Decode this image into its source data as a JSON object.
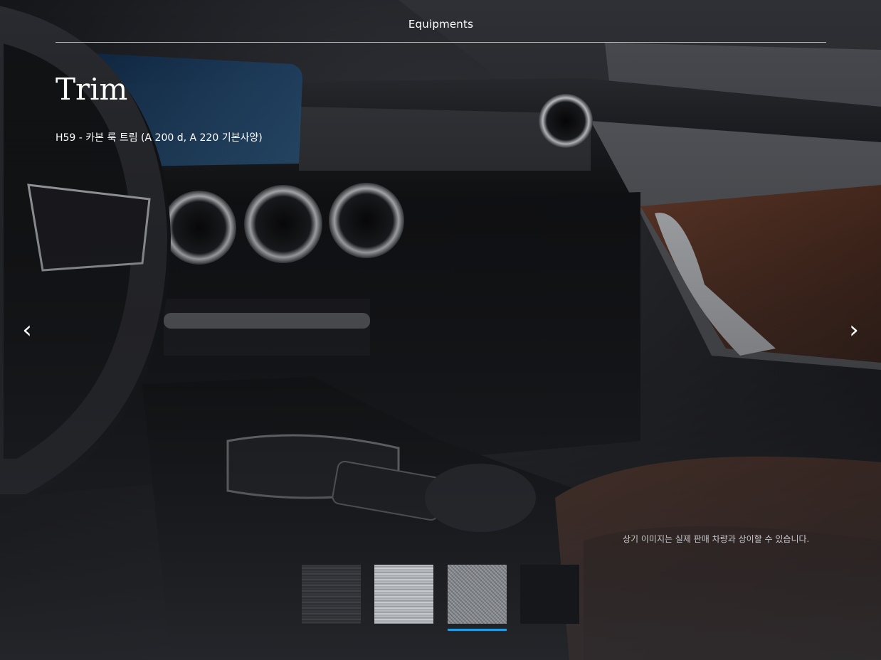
{
  "header": {
    "title": "Equipments"
  },
  "section": {
    "title": "Trim",
    "selected_trim": "H59 - 카본 룩 트림 (A 200 d, A 220 기본사양)"
  },
  "carousel": {
    "prev_icon": "chevron-left-icon",
    "next_icon": "chevron-right-icon",
    "prev_label": "‹",
    "next_label": "›"
  },
  "disclaimer": "상기 이미지는 실제 판매 차량과 상이할 수 있습니다.",
  "swatches": {
    "selected_index": 2,
    "items": [
      {
        "color": "#33343a"
      },
      {
        "color": "#b4b7bb"
      },
      {
        "color": "#8f9297"
      },
      {
        "color": "#15171b"
      }
    ]
  },
  "colors": {
    "accent": "#1f9ee6"
  }
}
